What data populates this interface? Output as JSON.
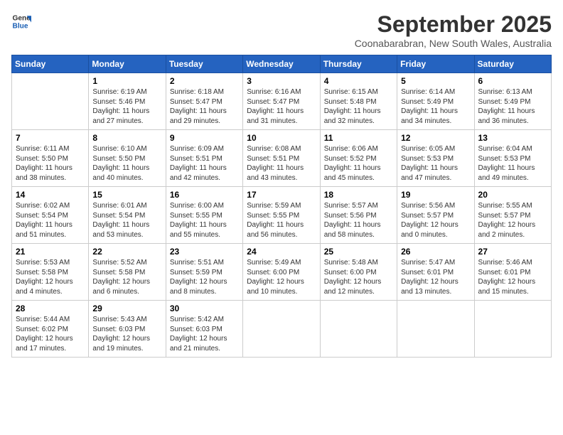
{
  "header": {
    "logo_line1": "General",
    "logo_line2": "Blue",
    "month": "September 2025",
    "location": "Coonabarabran, New South Wales, Australia"
  },
  "weekdays": [
    "Sunday",
    "Monday",
    "Tuesday",
    "Wednesday",
    "Thursday",
    "Friday",
    "Saturday"
  ],
  "weeks": [
    [
      {
        "day": "",
        "sunrise": "",
        "sunset": "",
        "daylight": ""
      },
      {
        "day": "1",
        "sunrise": "Sunrise: 6:19 AM",
        "sunset": "Sunset: 5:46 PM",
        "daylight": "Daylight: 11 hours and 27 minutes."
      },
      {
        "day": "2",
        "sunrise": "Sunrise: 6:18 AM",
        "sunset": "Sunset: 5:47 PM",
        "daylight": "Daylight: 11 hours and 29 minutes."
      },
      {
        "day": "3",
        "sunrise": "Sunrise: 6:16 AM",
        "sunset": "Sunset: 5:47 PM",
        "daylight": "Daylight: 11 hours and 31 minutes."
      },
      {
        "day": "4",
        "sunrise": "Sunrise: 6:15 AM",
        "sunset": "Sunset: 5:48 PM",
        "daylight": "Daylight: 11 hours and 32 minutes."
      },
      {
        "day": "5",
        "sunrise": "Sunrise: 6:14 AM",
        "sunset": "Sunset: 5:49 PM",
        "daylight": "Daylight: 11 hours and 34 minutes."
      },
      {
        "day": "6",
        "sunrise": "Sunrise: 6:13 AM",
        "sunset": "Sunset: 5:49 PM",
        "daylight": "Daylight: 11 hours and 36 minutes."
      }
    ],
    [
      {
        "day": "7",
        "sunrise": "Sunrise: 6:11 AM",
        "sunset": "Sunset: 5:50 PM",
        "daylight": "Daylight: 11 hours and 38 minutes."
      },
      {
        "day": "8",
        "sunrise": "Sunrise: 6:10 AM",
        "sunset": "Sunset: 5:50 PM",
        "daylight": "Daylight: 11 hours and 40 minutes."
      },
      {
        "day": "9",
        "sunrise": "Sunrise: 6:09 AM",
        "sunset": "Sunset: 5:51 PM",
        "daylight": "Daylight: 11 hours and 42 minutes."
      },
      {
        "day": "10",
        "sunrise": "Sunrise: 6:08 AM",
        "sunset": "Sunset: 5:51 PM",
        "daylight": "Daylight: 11 hours and 43 minutes."
      },
      {
        "day": "11",
        "sunrise": "Sunrise: 6:06 AM",
        "sunset": "Sunset: 5:52 PM",
        "daylight": "Daylight: 11 hours and 45 minutes."
      },
      {
        "day": "12",
        "sunrise": "Sunrise: 6:05 AM",
        "sunset": "Sunset: 5:53 PM",
        "daylight": "Daylight: 11 hours and 47 minutes."
      },
      {
        "day": "13",
        "sunrise": "Sunrise: 6:04 AM",
        "sunset": "Sunset: 5:53 PM",
        "daylight": "Daylight: 11 hours and 49 minutes."
      }
    ],
    [
      {
        "day": "14",
        "sunrise": "Sunrise: 6:02 AM",
        "sunset": "Sunset: 5:54 PM",
        "daylight": "Daylight: 11 hours and 51 minutes."
      },
      {
        "day": "15",
        "sunrise": "Sunrise: 6:01 AM",
        "sunset": "Sunset: 5:54 PM",
        "daylight": "Daylight: 11 hours and 53 minutes."
      },
      {
        "day": "16",
        "sunrise": "Sunrise: 6:00 AM",
        "sunset": "Sunset: 5:55 PM",
        "daylight": "Daylight: 11 hours and 55 minutes."
      },
      {
        "day": "17",
        "sunrise": "Sunrise: 5:59 AM",
        "sunset": "Sunset: 5:55 PM",
        "daylight": "Daylight: 11 hours and 56 minutes."
      },
      {
        "day": "18",
        "sunrise": "Sunrise: 5:57 AM",
        "sunset": "Sunset: 5:56 PM",
        "daylight": "Daylight: 11 hours and 58 minutes."
      },
      {
        "day": "19",
        "sunrise": "Sunrise: 5:56 AM",
        "sunset": "Sunset: 5:57 PM",
        "daylight": "Daylight: 12 hours and 0 minutes."
      },
      {
        "day": "20",
        "sunrise": "Sunrise: 5:55 AM",
        "sunset": "Sunset: 5:57 PM",
        "daylight": "Daylight: 12 hours and 2 minutes."
      }
    ],
    [
      {
        "day": "21",
        "sunrise": "Sunrise: 5:53 AM",
        "sunset": "Sunset: 5:58 PM",
        "daylight": "Daylight: 12 hours and 4 minutes."
      },
      {
        "day": "22",
        "sunrise": "Sunrise: 5:52 AM",
        "sunset": "Sunset: 5:58 PM",
        "daylight": "Daylight: 12 hours and 6 minutes."
      },
      {
        "day": "23",
        "sunrise": "Sunrise: 5:51 AM",
        "sunset": "Sunset: 5:59 PM",
        "daylight": "Daylight: 12 hours and 8 minutes."
      },
      {
        "day": "24",
        "sunrise": "Sunrise: 5:49 AM",
        "sunset": "Sunset: 6:00 PM",
        "daylight": "Daylight: 12 hours and 10 minutes."
      },
      {
        "day": "25",
        "sunrise": "Sunrise: 5:48 AM",
        "sunset": "Sunset: 6:00 PM",
        "daylight": "Daylight: 12 hours and 12 minutes."
      },
      {
        "day": "26",
        "sunrise": "Sunrise: 5:47 AM",
        "sunset": "Sunset: 6:01 PM",
        "daylight": "Daylight: 12 hours and 13 minutes."
      },
      {
        "day": "27",
        "sunrise": "Sunrise: 5:46 AM",
        "sunset": "Sunset: 6:01 PM",
        "daylight": "Daylight: 12 hours and 15 minutes."
      }
    ],
    [
      {
        "day": "28",
        "sunrise": "Sunrise: 5:44 AM",
        "sunset": "Sunset: 6:02 PM",
        "daylight": "Daylight: 12 hours and 17 minutes."
      },
      {
        "day": "29",
        "sunrise": "Sunrise: 5:43 AM",
        "sunset": "Sunset: 6:03 PM",
        "daylight": "Daylight: 12 hours and 19 minutes."
      },
      {
        "day": "30",
        "sunrise": "Sunrise: 5:42 AM",
        "sunset": "Sunset: 6:03 PM",
        "daylight": "Daylight: 12 hours and 21 minutes."
      },
      {
        "day": "",
        "sunrise": "",
        "sunset": "",
        "daylight": ""
      },
      {
        "day": "",
        "sunrise": "",
        "sunset": "",
        "daylight": ""
      },
      {
        "day": "",
        "sunrise": "",
        "sunset": "",
        "daylight": ""
      },
      {
        "day": "",
        "sunrise": "",
        "sunset": "",
        "daylight": ""
      }
    ]
  ]
}
